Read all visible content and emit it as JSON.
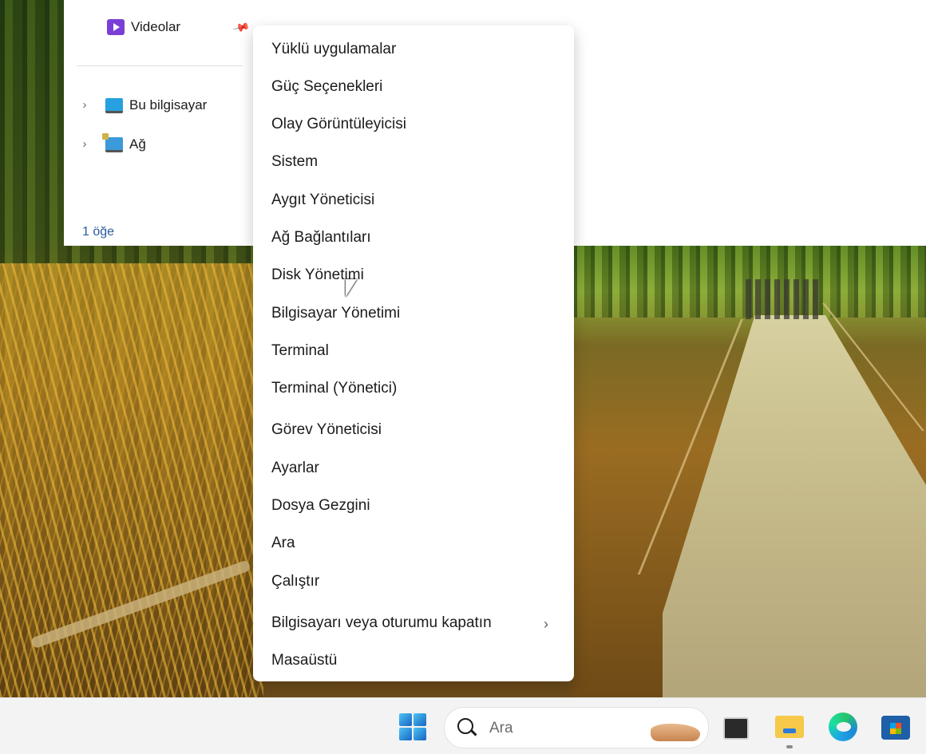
{
  "explorer": {
    "nav": {
      "videos_label": "Videolar",
      "this_pc_label": "Bu bilgisayar",
      "network_label": "Ağ"
    },
    "status_text": "1 öğe"
  },
  "context_menu": {
    "items": [
      "Yüklü uygulamalar",
      "Güç Seçenekleri",
      "Olay Görüntüleyicisi",
      "Sistem",
      "Aygıt Yöneticisi",
      "Ağ Bağlantıları",
      "Disk Yönetimi",
      "Bilgisayar Yönetimi",
      "Terminal",
      "Terminal (Yönetici)",
      "Görev Yöneticisi",
      "Ayarlar",
      "Dosya Gezgini",
      "Ara",
      "Çalıştır",
      "Bilgisayarı veya oturumu kapatın",
      "Masaüstü"
    ],
    "submenu_arrow": "›"
  },
  "taskbar": {
    "search_placeholder": "Ara",
    "icons": [
      "start-icon",
      "search-icon",
      "terminal-icon",
      "file-explorer-icon",
      "edge-icon",
      "store-icon"
    ]
  },
  "colors": {
    "accent": "#2a5a9e",
    "menu_bg": "#ffffff",
    "taskbar_bg": "#f3f3f3"
  }
}
